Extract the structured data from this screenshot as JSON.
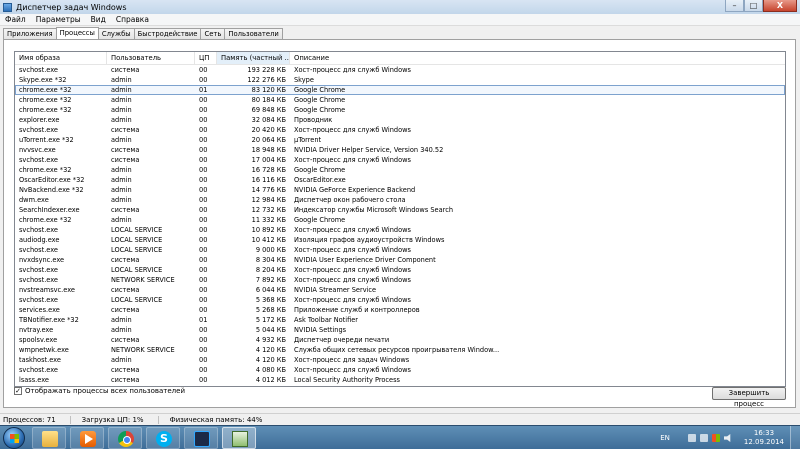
{
  "window": {
    "title": "Диспетчер задач Windows",
    "buttons": {
      "minimize": "–",
      "maximize": "□",
      "close": "X"
    }
  },
  "menu": [
    "Файл",
    "Параметры",
    "Вид",
    "Справка"
  ],
  "tabs": [
    {
      "label": "Приложения",
      "active": false
    },
    {
      "label": "Процессы",
      "active": true
    },
    {
      "label": "Службы",
      "active": false
    },
    {
      "label": "Быстродействие",
      "active": false
    },
    {
      "label": "Сеть",
      "active": false
    },
    {
      "label": "Пользователи",
      "active": false
    }
  ],
  "columns": {
    "name": "Имя образа",
    "user": "Пользователь",
    "cpu": "ЦП",
    "memory": "Память (частный ...",
    "description": "Описание"
  },
  "processes": [
    {
      "name": "svchost.exe",
      "user": "система",
      "cpu": "00",
      "memory": "193 228 КБ",
      "description": "Хост-процесс для служб Windows"
    },
    {
      "name": "Skype.exe *32",
      "user": "admin",
      "cpu": "00",
      "memory": "122 276 КБ",
      "description": "Skype"
    },
    {
      "name": "chrome.exe *32",
      "user": "admin",
      "cpu": "01",
      "memory": "83 120 КБ",
      "description": "Google Chrome",
      "selected": true
    },
    {
      "name": "chrome.exe *32",
      "user": "admin",
      "cpu": "00",
      "memory": "80 184 КБ",
      "description": "Google Chrome"
    },
    {
      "name": "chrome.exe *32",
      "user": "admin",
      "cpu": "00",
      "memory": "69 848 КБ",
      "description": "Google Chrome"
    },
    {
      "name": "explorer.exe",
      "user": "admin",
      "cpu": "00",
      "memory": "32 084 КБ",
      "description": "Проводник"
    },
    {
      "name": "svchost.exe",
      "user": "система",
      "cpu": "00",
      "memory": "20 420 КБ",
      "description": "Хост-процесс для служб Windows"
    },
    {
      "name": "uTorrent.exe *32",
      "user": "admin",
      "cpu": "00",
      "memory": "20 064 КБ",
      "description": "µTorrent"
    },
    {
      "name": "nvvsvc.exe",
      "user": "система",
      "cpu": "00",
      "memory": "18 948 КБ",
      "description": "NVIDIA Driver Helper Service, Version 340.52"
    },
    {
      "name": "svchost.exe",
      "user": "система",
      "cpu": "00",
      "memory": "17 004 КБ",
      "description": "Хост-процесс для служб Windows"
    },
    {
      "name": "chrome.exe *32",
      "user": "admin",
      "cpu": "00",
      "memory": "16 728 КБ",
      "description": "Google Chrome"
    },
    {
      "name": "OscarEditor.exe *32",
      "user": "admin",
      "cpu": "00",
      "memory": "16 116 КБ",
      "description": "OscarEditor.exe"
    },
    {
      "name": "NvBackend.exe *32",
      "user": "admin",
      "cpu": "00",
      "memory": "14 776 КБ",
      "description": "NVIDIA GeForce Experience Backend"
    },
    {
      "name": "dwm.exe",
      "user": "admin",
      "cpu": "00",
      "memory": "12 984 КБ",
      "description": "Диспетчер окон рабочего стола"
    },
    {
      "name": "SearchIndexer.exe",
      "user": "система",
      "cpu": "00",
      "memory": "12 732 КБ",
      "description": "Индексатор службы Microsoft Windows Search"
    },
    {
      "name": "chrome.exe *32",
      "user": "admin",
      "cpu": "00",
      "memory": "11 332 КБ",
      "description": "Google Chrome"
    },
    {
      "name": "svchost.exe",
      "user": "LOCAL SERVICE",
      "cpu": "00",
      "memory": "10 892 КБ",
      "description": "Хост-процесс для служб Windows"
    },
    {
      "name": "audiodg.exe",
      "user": "LOCAL SERVICE",
      "cpu": "00",
      "memory": "10 412 КБ",
      "description": "Изоляция графов аудиоустройств Windows"
    },
    {
      "name": "svchost.exe",
      "user": "LOCAL SERVICE",
      "cpu": "00",
      "memory": "9 000 КБ",
      "description": "Хост-процесс для служб Windows"
    },
    {
      "name": "nvxdsync.exe",
      "user": "система",
      "cpu": "00",
      "memory": "8 304 КБ",
      "description": "NVIDIA User Experience Driver Component"
    },
    {
      "name": "svchost.exe",
      "user": "LOCAL SERVICE",
      "cpu": "00",
      "memory": "8 204 КБ",
      "description": "Хост-процесс для служб Windows"
    },
    {
      "name": "svchost.exe",
      "user": "NETWORK SERVICE",
      "cpu": "00",
      "memory": "7 892 КБ",
      "description": "Хост-процесс для служб Windows"
    },
    {
      "name": "nvstreamsvc.exe",
      "user": "система",
      "cpu": "00",
      "memory": "6 044 КБ",
      "description": "NVIDIA Streamer Service"
    },
    {
      "name": "svchost.exe",
      "user": "LOCAL SERVICE",
      "cpu": "00",
      "memory": "5 368 КБ",
      "description": "Хост-процесс для служб Windows"
    },
    {
      "name": "services.exe",
      "user": "система",
      "cpu": "00",
      "memory": "5 268 КБ",
      "description": "Приложение служб и контроллеров"
    },
    {
      "name": "TBNotifier.exe *32",
      "user": "admin",
      "cpu": "01",
      "memory": "5 172 КБ",
      "description": "Ask Toolbar Notifier"
    },
    {
      "name": "nvtray.exe",
      "user": "admin",
      "cpu": "00",
      "memory": "5 044 КБ",
      "description": "NVIDIA Settings"
    },
    {
      "name": "spoolsv.exe",
      "user": "система",
      "cpu": "00",
      "memory": "4 932 КБ",
      "description": "Диспетчер очереди печати"
    },
    {
      "name": "wmpnetwk.exe",
      "user": "NETWORK SERVICE",
      "cpu": "00",
      "memory": "4 120 КБ",
      "description": "Служба общих сетевых ресурсов проигрывателя Window..."
    },
    {
      "name": "taskhost.exe",
      "user": "admin",
      "cpu": "00",
      "memory": "4 120 КБ",
      "description": "Хост-процесс для задач Windows"
    },
    {
      "name": "svchost.exe",
      "user": "система",
      "cpu": "00",
      "memory": "4 080 КБ",
      "description": "Хост-процесс для служб Windows"
    },
    {
      "name": "lsass.exe",
      "user": "система",
      "cpu": "00",
      "memory": "4 012 КБ",
      "description": "Local Security Authority Process"
    }
  ],
  "show_all_label": "Отображать процессы всех пользователей",
  "show_all_checked": "✓",
  "end_process_label": "Завершить процесс",
  "status": {
    "processes": "Процессов: 71",
    "cpu": "Загрузка ЦП: 1%",
    "memory": "Физическая память: 44%"
  },
  "taskbar": {
    "skype_glyph": "S",
    "lang": "EN",
    "time": "16:33",
    "date": "12.09.2014"
  }
}
